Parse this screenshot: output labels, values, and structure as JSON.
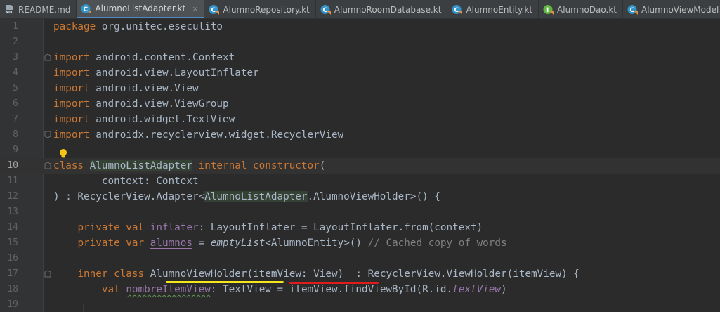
{
  "tabs": [
    {
      "name": "README.md",
      "icon": "markdown-file-icon",
      "active": false
    },
    {
      "name": "AlumnoListAdapter.kt",
      "icon": "kotlin-class-icon",
      "active": true,
      "close": "×"
    },
    {
      "name": "AlumnoRepository.kt",
      "icon": "kotlin-class-icon",
      "active": false
    },
    {
      "name": "AlumnoRoomDatabase.kt",
      "icon": "kotlin-class-icon",
      "active": false
    },
    {
      "name": "AlumnoEntity.kt",
      "icon": "kotlin-class-icon",
      "active": false
    },
    {
      "name": "AlumnoDao.kt",
      "icon": "kotlin-interface-icon",
      "active": false
    },
    {
      "name": "AlumnoViewModel",
      "icon": "kotlin-class-icon",
      "active": false
    }
  ],
  "editor": {
    "current_line": 10,
    "line_numbers": [
      "1",
      "2",
      "3",
      "4",
      "5",
      "6",
      "7",
      "8",
      "9",
      "10",
      "11",
      "12",
      "13",
      "14",
      "15",
      "16",
      "17",
      "18",
      "19"
    ],
    "l1": {
      "kw": "package",
      "rest": " org.unitec.eseculito"
    },
    "imports": [
      {
        "kw": "import",
        "path": " android.content.Context"
      },
      {
        "kw": "import",
        "path": " android.view.LayoutInflater"
      },
      {
        "kw": "import",
        "path": " android.view.View"
      },
      {
        "kw": "import",
        "path": " android.view.ViewGroup"
      },
      {
        "kw": "import",
        "path": " android.widget.TextView"
      },
      {
        "kw": "import",
        "path": " androidx.recyclerview.widget.RecyclerView"
      }
    ],
    "l10": {
      "kw1": "class",
      "sp": " ",
      "name": "AlumnoListAdapter",
      "kw2": " internal constructor",
      "paren": "("
    },
    "l11": {
      "text": "        context: Context"
    },
    "l12": {
      "a": ") : RecyclerView.Adapter<",
      "b": "AlumnoListAdapter",
      "c": ".AlumnoViewHolder>() {"
    },
    "l14": {
      "indent": "    ",
      "kw": "private val",
      "sp": " ",
      "prop": "inflater",
      "rest": ": LayoutInflater = LayoutInflater.from(context)"
    },
    "l15": {
      "indent": "    ",
      "kw": "private var",
      "sp": " ",
      "prop": "alumnos",
      "eq": " = ",
      "fn": "emptyList",
      "gen": "<AlumnoEntity>()",
      "sp2": " ",
      "comment": "// Cached copy of words"
    },
    "l17": {
      "indent": "    ",
      "kw": "inner class",
      "sp": " ",
      "name": "AlumnoViewHolder",
      "args": "(itemView: View)",
      "rest": "  : RecyclerView.ViewHolder(itemView) {"
    },
    "l18": {
      "indent": "        ",
      "kw": "val",
      "sp": " ",
      "prop": "nombreItemView",
      "a": ": TextView = itemView.findViewById(R.id.",
      "b": "textView",
      "c": ")"
    }
  },
  "colors": {
    "background": "#2b2b2b",
    "gutter": "#313335",
    "keyword": "#cc7832",
    "plain": "#a9b7c6",
    "property": "#9876aa",
    "comment": "#808080",
    "yellow_mark": "#f5e51b",
    "red_mark": "#e01b1b"
  }
}
